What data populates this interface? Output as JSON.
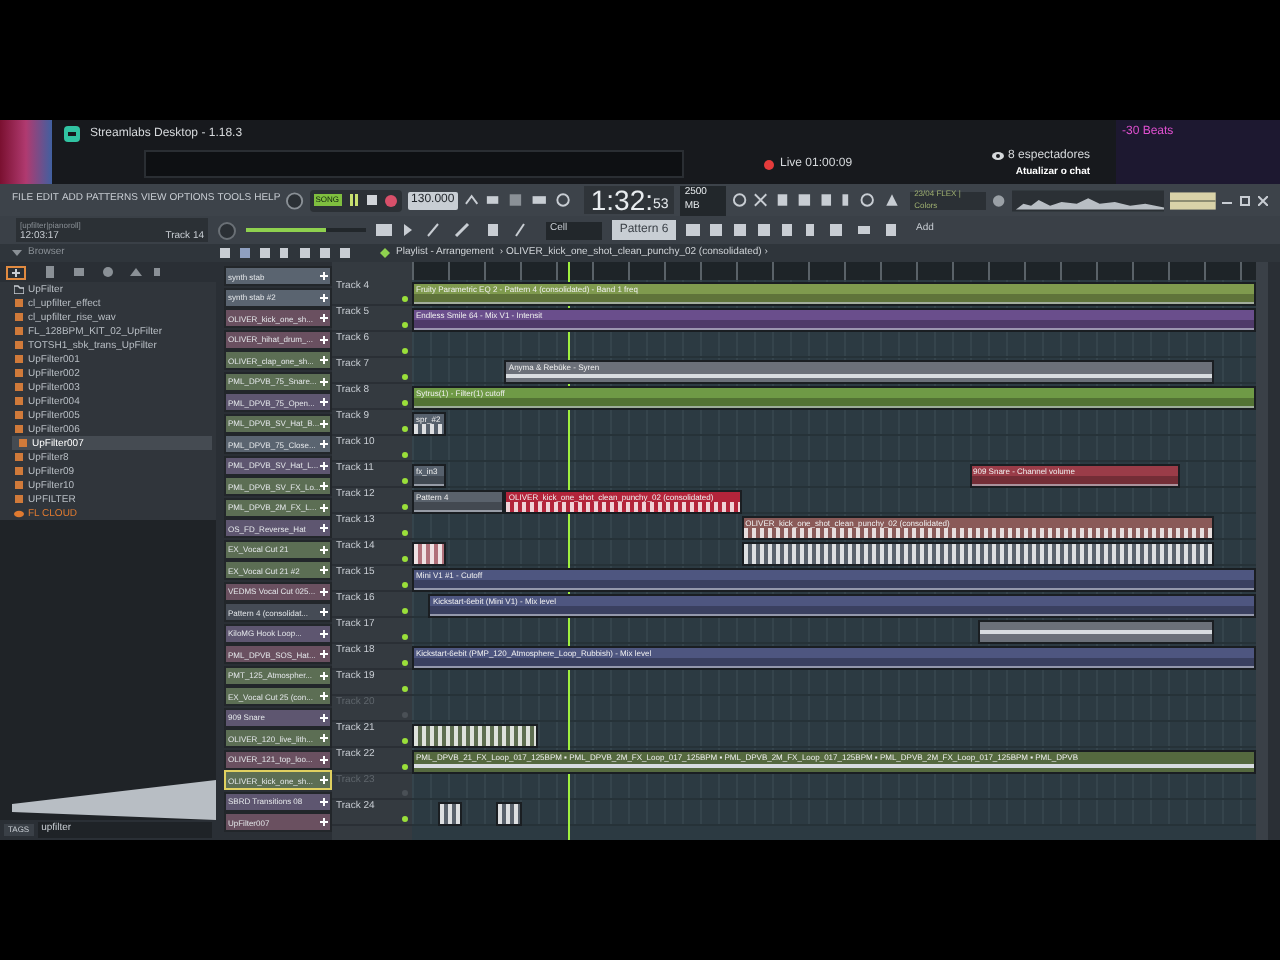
{
  "streamlabs": {
    "title": "Streamlabs Desktop - 1.18.3",
    "live": "Live 01:00:09",
    "viewers": "8 espectadores",
    "refresh_chat": "Atualizar o chat",
    "overlay_label": "-30 Beats"
  },
  "toolbar": {
    "menu": [
      "FILE",
      "EDIT",
      "ADD",
      "PATTERNS",
      "VIEW",
      "OPTIONS",
      "TOOLS",
      "HELP"
    ],
    "hint_title": "[upfilter|pianoroll]",
    "hint_time": "12:03:17",
    "hint_track": "Track 14",
    "mode": "SONG",
    "tempo": "130.000",
    "time": "1:32:",
    "time_small": "53",
    "memory": "2500 MB",
    "info": "23/04 FLEX | Colors",
    "master_volume": {
      "level": 0.67
    },
    "snap": "Cell",
    "pattern": "Pattern 6",
    "add": "Add"
  },
  "browser": {
    "title": "Browser",
    "search": "upfilter",
    "tags": "TAGS",
    "items": [
      {
        "label": "UpFilter",
        "kind": "folder",
        "selected": false
      },
      {
        "label": "cl_upfilter_effect",
        "kind": "file",
        "selected": false
      },
      {
        "label": "cl_upfilter_rise_wav",
        "kind": "file",
        "selected": false
      },
      {
        "label": "FL_128BPM_KIT_02_UpFilter",
        "kind": "file",
        "selected": false
      },
      {
        "label": "TOTSH1_sbk_trans_UpFilter",
        "kind": "file",
        "selected": false
      },
      {
        "label": "UpFilter001",
        "kind": "file",
        "selected": false
      },
      {
        "label": "UpFilter002",
        "kind": "file",
        "selected": false
      },
      {
        "label": "UpFilter003",
        "kind": "file",
        "selected": false
      },
      {
        "label": "UpFilter004",
        "kind": "file",
        "selected": false
      },
      {
        "label": "UpFilter005",
        "kind": "file",
        "selected": false
      },
      {
        "label": "UpFilter006",
        "kind": "file",
        "selected": false
      },
      {
        "label": "UpFilter007",
        "kind": "file",
        "selected": true
      },
      {
        "label": "UpFilter8",
        "kind": "file",
        "selected": false
      },
      {
        "label": "UpFilter09",
        "kind": "file",
        "selected": false
      },
      {
        "label": "UpFilter10",
        "kind": "file",
        "selected": false
      },
      {
        "label": "UPFILTER",
        "kind": "file",
        "selected": false
      },
      {
        "label": "FL CLOUD",
        "kind": "cloud",
        "selected": false
      }
    ]
  },
  "channels": [
    {
      "label": "synth stab",
      "color": "#5a6470",
      "selected": false
    },
    {
      "label": "synth stab #2",
      "color": "#5a6470",
      "selected": false
    },
    {
      "label": "OLIVER_kick_one_sh...",
      "color": "#6a5060",
      "selected": false
    },
    {
      "label": "OLIVER_hihat_drum_...",
      "color": "#6a5060",
      "selected": false
    },
    {
      "label": "OLIVER_clap_one_sh...",
      "color": "#5c6e54",
      "selected": false
    },
    {
      "label": "PML_DPVB_75_Snare...",
      "color": "#5c6e54",
      "selected": false
    },
    {
      "label": "PML_DPVB_75_Open...",
      "color": "#5e5670",
      "selected": false
    },
    {
      "label": "PML_DPVB_SV_Hat_B...",
      "color": "#5c6e54",
      "selected": false
    },
    {
      "label": "PML_DPVB_75_Close...",
      "color": "#5a6470",
      "selected": false
    },
    {
      "label": "PML_DPVB_SV_Hat_L...",
      "color": "#5e5670",
      "selected": false
    },
    {
      "label": "PML_DPVB_SV_FX_Lo...",
      "color": "#5c6e54",
      "selected": false
    },
    {
      "label": "PML_DPVB_2M_FX_L...",
      "color": "#5c6e54",
      "selected": false
    },
    {
      "label": "OS_FD_Reverse_Hat",
      "color": "#5e5670",
      "selected": false
    },
    {
      "label": "EX_Vocal Cut 21",
      "color": "#5c6e54",
      "selected": false
    },
    {
      "label": "EX_Vocal Cut 21 #2",
      "color": "#5c6e54",
      "selected": false
    },
    {
      "label": "VEDMS Vocal Cut 025...",
      "color": "#6a5060",
      "selected": false
    },
    {
      "label": "Pattern 4 (consolidat...",
      "color": "#454b55",
      "selected": false
    },
    {
      "label": "KiloMG Hook Loop...",
      "color": "#5e5670",
      "selected": false
    },
    {
      "label": "PML_DPVB_SOS_Hat...",
      "color": "#6a5060",
      "selected": false
    },
    {
      "label": "PMT_125_Atmospher...",
      "color": "#5c6e54",
      "selected": false
    },
    {
      "label": "EX_Vocal Cut 25 (con...",
      "color": "#5c6e54",
      "selected": false
    },
    {
      "label": "909 Snare",
      "color": "#5e5670",
      "selected": false
    },
    {
      "label": "OLIVER_120_live_lith...",
      "color": "#5c6e54",
      "selected": false
    },
    {
      "label": "OLIVER_121_top_loo...",
      "color": "#6a5060",
      "selected": false
    },
    {
      "label": "OLIVER_kick_one_sh...",
      "color": "#5c6e54",
      "selected": true
    },
    {
      "label": "SBRD Transitions 08",
      "color": "#5e5670",
      "selected": false
    },
    {
      "label": "UpFilter007",
      "color": "#6a5060",
      "selected": false
    }
  ],
  "playlist": {
    "title": "Playlist - Arrangement",
    "path": "› OLIVER_kick_one_shot_clean_punchy_02 (consolidated) ›",
    "tracks": [
      {
        "name": "Track 4",
        "muted": false,
        "clips": [
          {
            "label": "Fruity Parametric EQ 2 - Pattern 4 (consolidated) - Band 1 freq",
            "kind": "automation",
            "color": "#7f9a4e"
          }
        ]
      },
      {
        "name": "Track 5",
        "muted": false,
        "clips": [
          {
            "label": "Endless Smile 64 - Mix V1 - Intensit",
            "kind": "automation",
            "color": "#6a4e8c"
          }
        ]
      },
      {
        "name": "Track 6",
        "muted": false
      },
      {
        "name": "Track 7",
        "muted": false,
        "clips": [
          {
            "label": "Anyma & Rebūke - Syren",
            "kind": "audio",
            "color": "#6b7079"
          }
        ]
      },
      {
        "name": "Track 8",
        "muted": false,
        "clips": [
          {
            "label": "Sytrus(1) - Filter(1) cutoff",
            "kind": "automation",
            "color": "#6f9a46"
          }
        ]
      },
      {
        "name": "Track 9",
        "muted": false,
        "clips": [
          {
            "label": "spr_#2",
            "kind": "pattern",
            "color": "#56606c"
          }
        ]
      },
      {
        "name": "Track 10",
        "muted": false
      },
      {
        "name": "Track 11",
        "muted": false,
        "clips": [
          {
            "label": "fx_in3",
            "kind": "automation",
            "color": "#56606c"
          },
          {
            "label": "909 Snare - Channel volume",
            "kind": "automation",
            "color": "#9a3c48"
          }
        ]
      },
      {
        "name": "Track 12",
        "muted": false,
        "clips": [
          {
            "label": "Pattern 4",
            "kind": "automation",
            "color": "#5a626c"
          },
          {
            "label": "OLIVER_kick_one_shot_clean_punchy_02 (consolidated)",
            "kind": "pattern",
            "color": "#b3243a"
          }
        ]
      },
      {
        "name": "Track 13",
        "muted": false,
        "clips": [
          {
            "label": "OLIVER_kick_one_shot_clean_punchy_02 (consolidated)",
            "kind": "pattern",
            "color": "#8a5a58"
          }
        ]
      },
      {
        "name": "Track 14",
        "muted": false,
        "clips": [
          {
            "kind": "pattern",
            "color": "#b0707a"
          },
          {
            "kind": "pattern",
            "color": "#5a626c"
          }
        ]
      },
      {
        "name": "Track 15",
        "muted": false,
        "clips": [
          {
            "label": "Mini V1 #1 - Cutoff",
            "kind": "automation",
            "color": "#4e5680"
          }
        ]
      },
      {
        "name": "Track 16",
        "muted": false,
        "clips": [
          {
            "label": "Kickstart-6ebit (Mini V1) - Mix level",
            "kind": "automation",
            "color": "#4e5680"
          }
        ]
      },
      {
        "name": "Track 17",
        "muted": false,
        "clips": [
          {
            "kind": "audio",
            "color": "#6b7079"
          }
        ]
      },
      {
        "name": "Track 18",
        "muted": false,
        "clips": [
          {
            "label": "Kickstart-6ebit (PMP_120_Atmosphere_Loop_Rubbish) - Mix level",
            "kind": "automation",
            "color": "#4e5680"
          }
        ]
      },
      {
        "name": "Track 19",
        "muted": false
      },
      {
        "name": "Track 20",
        "muted": true
      },
      {
        "name": "Track 21",
        "muted": false,
        "clips": [
          {
            "kind": "pattern",
            "color": "#5e6e50"
          }
        ]
      },
      {
        "name": "Track 22",
        "muted": false,
        "clips": [
          {
            "label": "PML_DPVB_21_FX_Loop_017_125BPM ▪ PML_DPVB_2M_FX_Loop_017_125BPM ▪ PML_DPVB_2M_FX_Loop_017_125BPM ▪ PML_DPVB_2M_FX_Loop_017_125BPM ▪ PML_DPVB",
            "kind": "audio",
            "color": "#55693f"
          }
        ]
      },
      {
        "name": "Track 23",
        "muted": true
      },
      {
        "name": "Track 24",
        "muted": false,
        "clips": [
          {
            "kind": "pattern",
            "color": "#5a626c"
          },
          {
            "kind": "pattern",
            "color": "#5a626c"
          }
        ]
      }
    ]
  }
}
